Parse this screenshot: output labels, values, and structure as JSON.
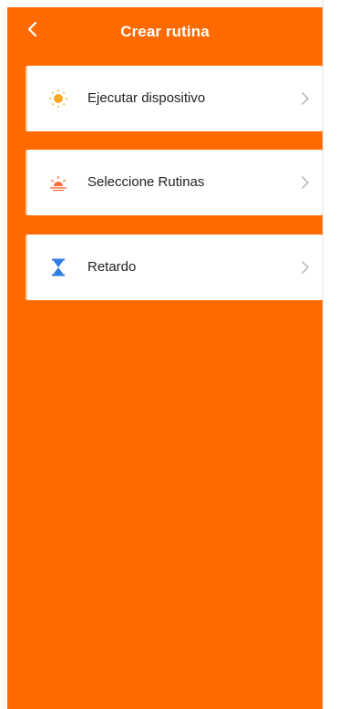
{
  "header": {
    "title": "Crear rutina",
    "back_icon": "chevron-left-icon"
  },
  "options": [
    {
      "label": "Ejecutar dispositivo",
      "icon": "sun-icon"
    },
    {
      "label": "Seleccione Rutinas",
      "icon": "sunrise-icon"
    },
    {
      "label": "Retardo",
      "icon": "hourglass-icon"
    }
  ],
  "colors": {
    "background": "#ff6a00",
    "card": "#ffffff",
    "sun": "#f9a825",
    "sunrise": "#ff6b3d",
    "hourglass": "#2f7de1",
    "chevron": "#b5b5b5"
  }
}
